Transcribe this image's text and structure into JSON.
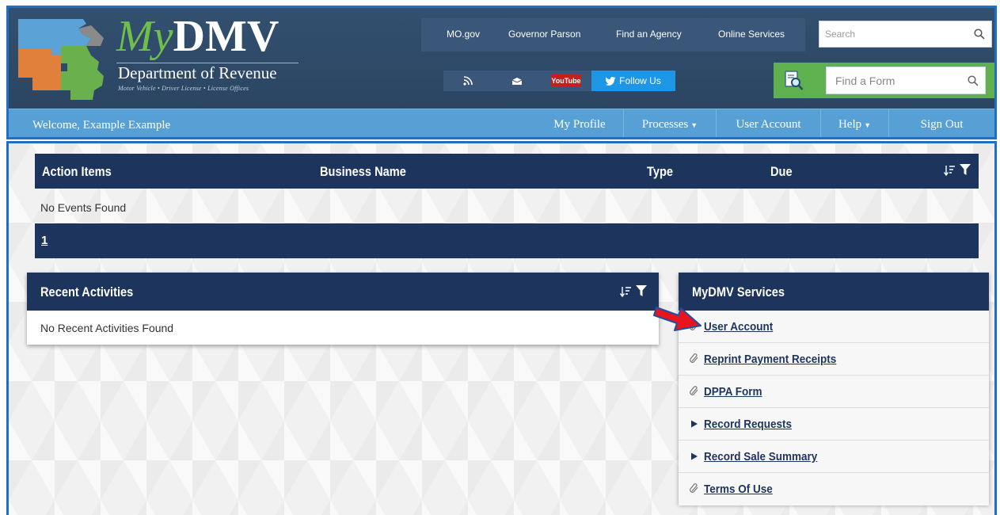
{
  "header": {
    "logo": {
      "title_my": "My",
      "title_dmv": "DMV",
      "department": "Department of Revenue",
      "subtitle": "Motor Vehicle  •  Driver License  •  License Offices"
    },
    "utility_links": [
      "MO.gov",
      "Governor Parson",
      "Find an Agency",
      "Online Services"
    ],
    "search": {
      "placeholder": "Search",
      "icon": "search-icon"
    },
    "social": {
      "rss_icon": "rss-icon",
      "email_icon": "email-icon",
      "youtube": "YouTube",
      "follow": "Follow Us"
    },
    "form_finder": {
      "placeholder": "Find a Form",
      "icon": "document-search-icon"
    },
    "colors": {
      "nav_blue": "#57a0d5",
      "header_navy": "#2e4564",
      "form_green": "#5fb04f",
      "dark_bar": "#1d355c"
    }
  },
  "nav": {
    "welcome": "Welcome, Example Example",
    "my_profile": "My Profile",
    "processes": "Processes",
    "user_account": "User Account",
    "help": "Help",
    "sign_out": "Sign Out"
  },
  "action_items": {
    "columns": [
      "Action Items",
      "Business Name",
      "Type",
      "Due"
    ],
    "empty": "No Events Found",
    "page": "1"
  },
  "recent_activities": {
    "title": "Recent Activities",
    "empty": "No Recent Activities Found"
  },
  "services": {
    "title": "MyDMV Services",
    "items": [
      {
        "label": "User Account",
        "icon": "link-icon"
      },
      {
        "label": "Reprint Payment Receipts",
        "icon": "link-icon"
      },
      {
        "label": "DPPA Form",
        "icon": "link-icon"
      },
      {
        "label": "Record Requests",
        "icon": "expand-arrow-icon"
      },
      {
        "label": "Record Sale Summary",
        "icon": "expand-arrow-icon"
      },
      {
        "label": "Terms Of Use",
        "icon": "link-icon"
      }
    ]
  }
}
